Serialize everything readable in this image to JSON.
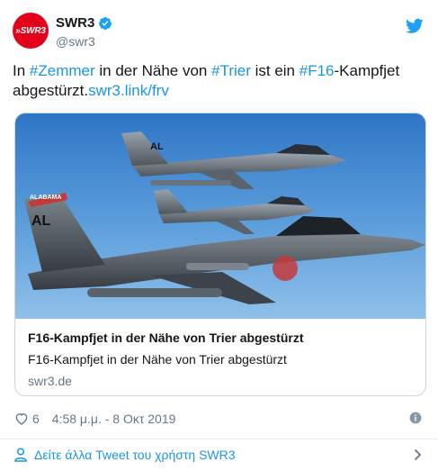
{
  "author": {
    "avatar_text": "»SWR3",
    "display_name": "SWR3",
    "handle": "@swr3"
  },
  "tweet": {
    "parts": [
      {
        "text": "In ",
        "link": false
      },
      {
        "text": "#Zemmer",
        "link": true
      },
      {
        "text": " in der Nähe von ",
        "link": false
      },
      {
        "text": "#Trier",
        "link": true
      },
      {
        "text": " ist ein ",
        "link": false
      },
      {
        "text": "#F16",
        "link": true
      },
      {
        "text": "-Kampfjet abgestürzt.",
        "link": false
      },
      {
        "text": "swr3.link/frv",
        "link": true
      }
    ]
  },
  "card": {
    "image_name": "f16-jets-photo",
    "tail_labels": [
      "AL",
      "AL",
      "ALABAMA"
    ],
    "title": "F16-Kampfjet in der Nähe von Trier abgestürzt",
    "description": "F16-Kampfjet in der Nähe von Trier abgestürzt",
    "domain": "swr3.de"
  },
  "footer": {
    "likes": "6",
    "timestamp": "4:58 μ.μ. - 8 Οκτ 2019"
  },
  "more_tweets": "Δείτε άλλα Tweet του χρήστη SWR3",
  "colors": {
    "link": "#1b95e0",
    "brand_red": "#e3001b",
    "muted": "#657786",
    "border": "#ccd6dd"
  },
  "icons": [
    "verified-icon",
    "twitter-bird-icon",
    "heart-icon",
    "info-icon",
    "user-icon",
    "chevron-right-icon"
  ]
}
